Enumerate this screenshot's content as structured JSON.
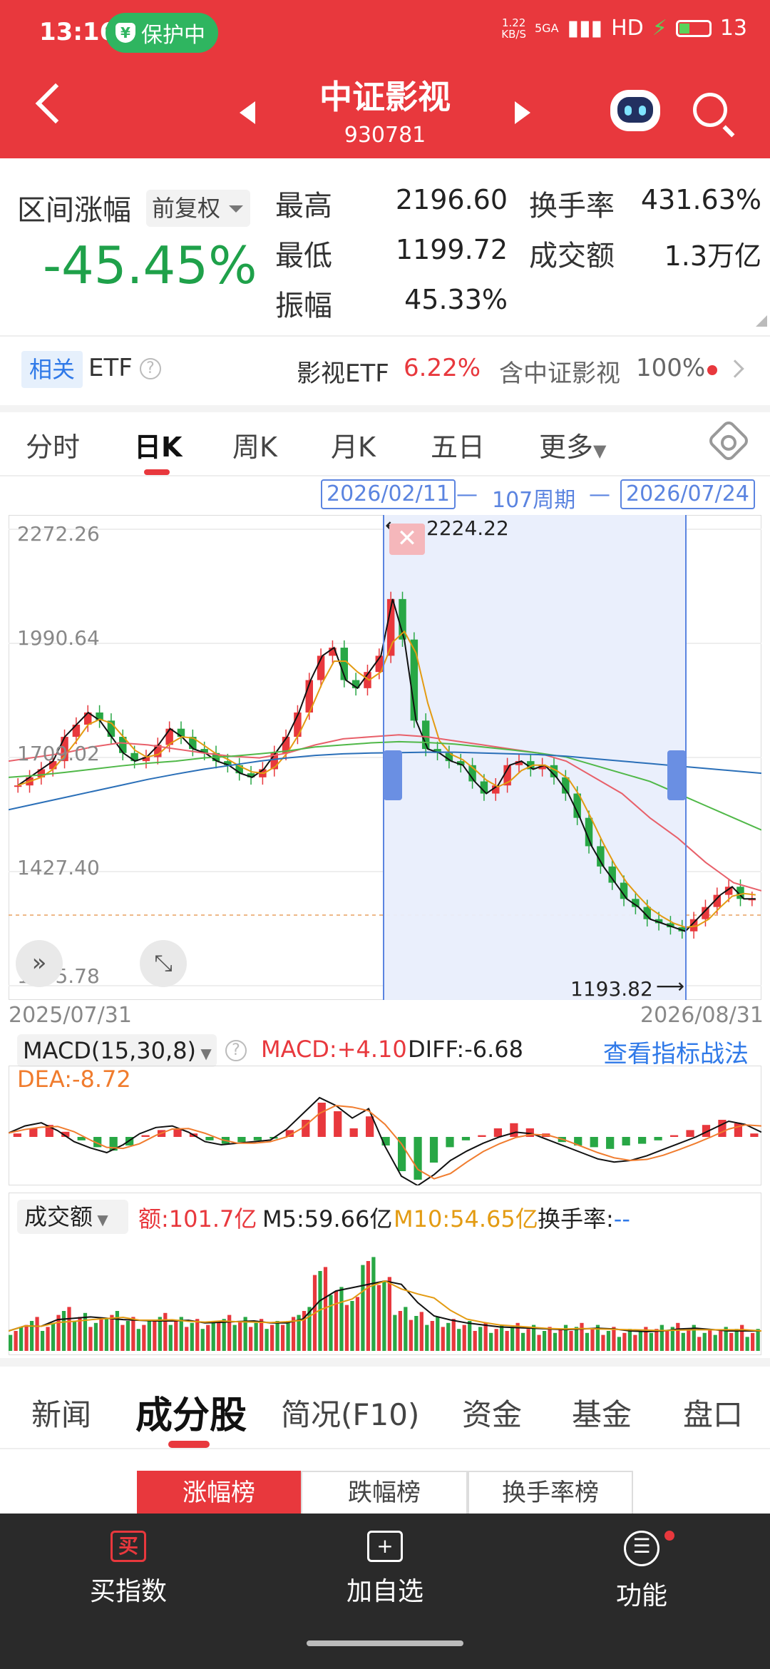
{
  "status_bar": {
    "time": "13:16",
    "protect_label": "保护中",
    "net_speed_value": "1.22",
    "net_speed_unit": "KB/S",
    "network": "5GA",
    "hd": "HD",
    "battery": "13"
  },
  "header": {
    "title": "中证影视",
    "code": "930781"
  },
  "summary": {
    "range_label": "区间涨幅",
    "adjust_label": "前复权",
    "range_change": "-45.45%",
    "high_label": "最高",
    "high_value": "2196.60",
    "low_label": "最低",
    "low_value": "1199.72",
    "amp_label": "振幅",
    "amp_value": "45.33%",
    "turnover_label": "换手率",
    "turnover_value": "431.63%",
    "amount_label": "成交额",
    "amount_value": "1.3万亿"
  },
  "etf": {
    "related_badge": "相关",
    "etf_label": "ETF",
    "etf_name": "影视ETF",
    "etf_change": "6.22%",
    "contains_label": "含中证影视",
    "contains_pct": "100%"
  },
  "tabs": {
    "t1": "分时",
    "t2": "日K",
    "t3": "周K",
    "t4": "月K",
    "t5": "五日",
    "t6": "更多"
  },
  "selection": {
    "start": "2026/02/11",
    "dash": "—",
    "period": "107周期",
    "end": "2026/07/24"
  },
  "kline": {
    "y_labels": [
      "2272.26",
      "1990.64",
      "1709.02",
      "1427.40",
      "1145.78"
    ],
    "x_start": "2025/07/31",
    "x_end": "2026/08/31",
    "high_mark": "2224.22",
    "low_mark": "1193.82"
  },
  "macd": {
    "label": "MACD(15,30,8)",
    "macd": "MACD:+4.10",
    "diff": "DIFF:-6.68",
    "dea": "DEA:-8.72",
    "link": "查看指标战法"
  },
  "volume": {
    "label": "成交额",
    "amount": "额:101.7亿",
    "m5": "M5:59.66亿",
    "m10": "M10:54.65亿",
    "turnover": "换手率:",
    "turnover_value": "--"
  },
  "bottom_tabs": {
    "news": "新闻",
    "components": "成分股",
    "profile": "简况(F10)",
    "funds": "资金",
    "fund": "基金",
    "book": "盘口"
  },
  "rank_tabs": {
    "gain": "涨幅榜",
    "loss": "跌幅榜",
    "turnover": "换手率榜"
  },
  "bottom_bar": {
    "buy": "买指数",
    "buy_icon": "买",
    "add": "加自选",
    "add_icon": "+",
    "func": "功能",
    "func_icon": "☰"
  },
  "chart_data": {
    "type": "candlestick",
    "title": "中证影视",
    "x_range": [
      "2025/07/31",
      "2026/08/31"
    ],
    "ylim": [
      1145.78,
      2272.26
    ],
    "y_ticks": [
      2272.26,
      1990.64,
      1709.02,
      1427.4,
      1145.78
    ],
    "selection": {
      "start": "2026/02/11",
      "end": "2026/07/24",
      "periods": 107
    },
    "annotations": [
      {
        "label": "2224.22",
        "type": "high"
      },
      {
        "label": "1193.82",
        "type": "low"
      }
    ],
    "close_path": [
      1640,
      1660,
      1680,
      1700,
      1760,
      1790,
      1820,
      1800,
      1760,
      1720,
      1700,
      1710,
      1740,
      1780,
      1760,
      1730,
      1720,
      1700,
      1690,
      1670,
      1660,
      1680,
      1720,
      1760,
      1820,
      1900,
      1960,
      1980,
      1900,
      1880,
      1920,
      1960,
      2100,
      2000,
      1800,
      1730,
      1720,
      1700,
      1690,
      1650,
      1620,
      1640,
      1690,
      1700,
      1680,
      1690,
      1660,
      1620,
      1560,
      1490,
      1440,
      1400,
      1360,
      1340,
      1310,
      1300,
      1290,
      1280,
      1310,
      1340,
      1370,
      1390,
      1360,
      1360
    ],
    "ma_series": [
      {
        "name": "MA",
        "color": "#e8606a",
        "values": [
          1700,
          1710,
          1720,
          1735,
          1745,
          1740,
          1730,
          1720,
          1712,
          1708,
          1720,
          1740,
          1755,
          1760,
          1765,
          1760,
          1750,
          1740,
          1730,
          1720,
          1700,
          1660,
          1620,
          1560,
          1510,
          1450,
          1400,
          1380
        ]
      },
      {
        "name": "MA",
        "color": "#50b848",
        "values": [
          1660,
          1665,
          1672,
          1680,
          1688,
          1695,
          1700,
          1708,
          1712,
          1718,
          1725,
          1735,
          1740,
          1745,
          1748,
          1746,
          1742,
          1735,
          1728,
          1720,
          1710,
          1690,
          1670,
          1650,
          1620,
          1590,
          1560,
          1530
        ]
      },
      {
        "name": "MA",
        "color": "#2a6fb8",
        "values": [
          1580,
          1595,
          1610,
          1625,
          1640,
          1655,
          1668,
          1680,
          1690,
          1700,
          1708,
          1714,
          1718,
          1720,
          1721,
          1722,
          1722,
          1720,
          1718,
          1716,
          1712,
          1706,
          1700,
          1694,
          1688,
          1682,
          1676,
          1670
        ]
      }
    ],
    "macd_histogram": [
      4,
      10,
      14,
      6,
      -4,
      -12,
      -16,
      -10,
      2,
      8,
      10,
      4,
      -4,
      -8,
      -6,
      -4,
      -2,
      8,
      20,
      40,
      30,
      10,
      24,
      -10,
      -40,
      -50,
      -30,
      -12,
      -4,
      2,
      10,
      16,
      10,
      4,
      -6,
      -10,
      -12,
      -14,
      -10,
      -8,
      -4,
      2,
      8,
      14,
      20,
      16,
      4
    ],
    "macd_diff": [
      5,
      14,
      18,
      8,
      -6,
      -14,
      -20,
      -10,
      4,
      12,
      14,
      6,
      -6,
      -10,
      -8,
      -6,
      -4,
      10,
      30,
      50,
      40,
      24,
      36,
      -12,
      -50,
      -62,
      -48,
      -30,
      -18,
      -8,
      0,
      6,
      4,
      -4,
      -12,
      -20,
      -28,
      -32,
      -30,
      -24,
      -16,
      -8,
      0,
      10,
      20,
      16,
      6
    ],
    "volume_values": [
      20,
      30,
      24,
      40,
      34,
      28,
      36,
      30,
      26,
      34,
      30,
      28,
      26,
      32,
      30,
      28,
      26,
      30,
      40,
      80,
      60,
      50,
      90,
      70,
      40,
      35,
      30,
      28,
      26,
      24,
      22,
      24,
      22,
      20,
      22,
      24,
      22,
      20,
      18,
      20,
      22,
      24,
      22,
      18,
      20,
      22,
      18
    ]
  }
}
